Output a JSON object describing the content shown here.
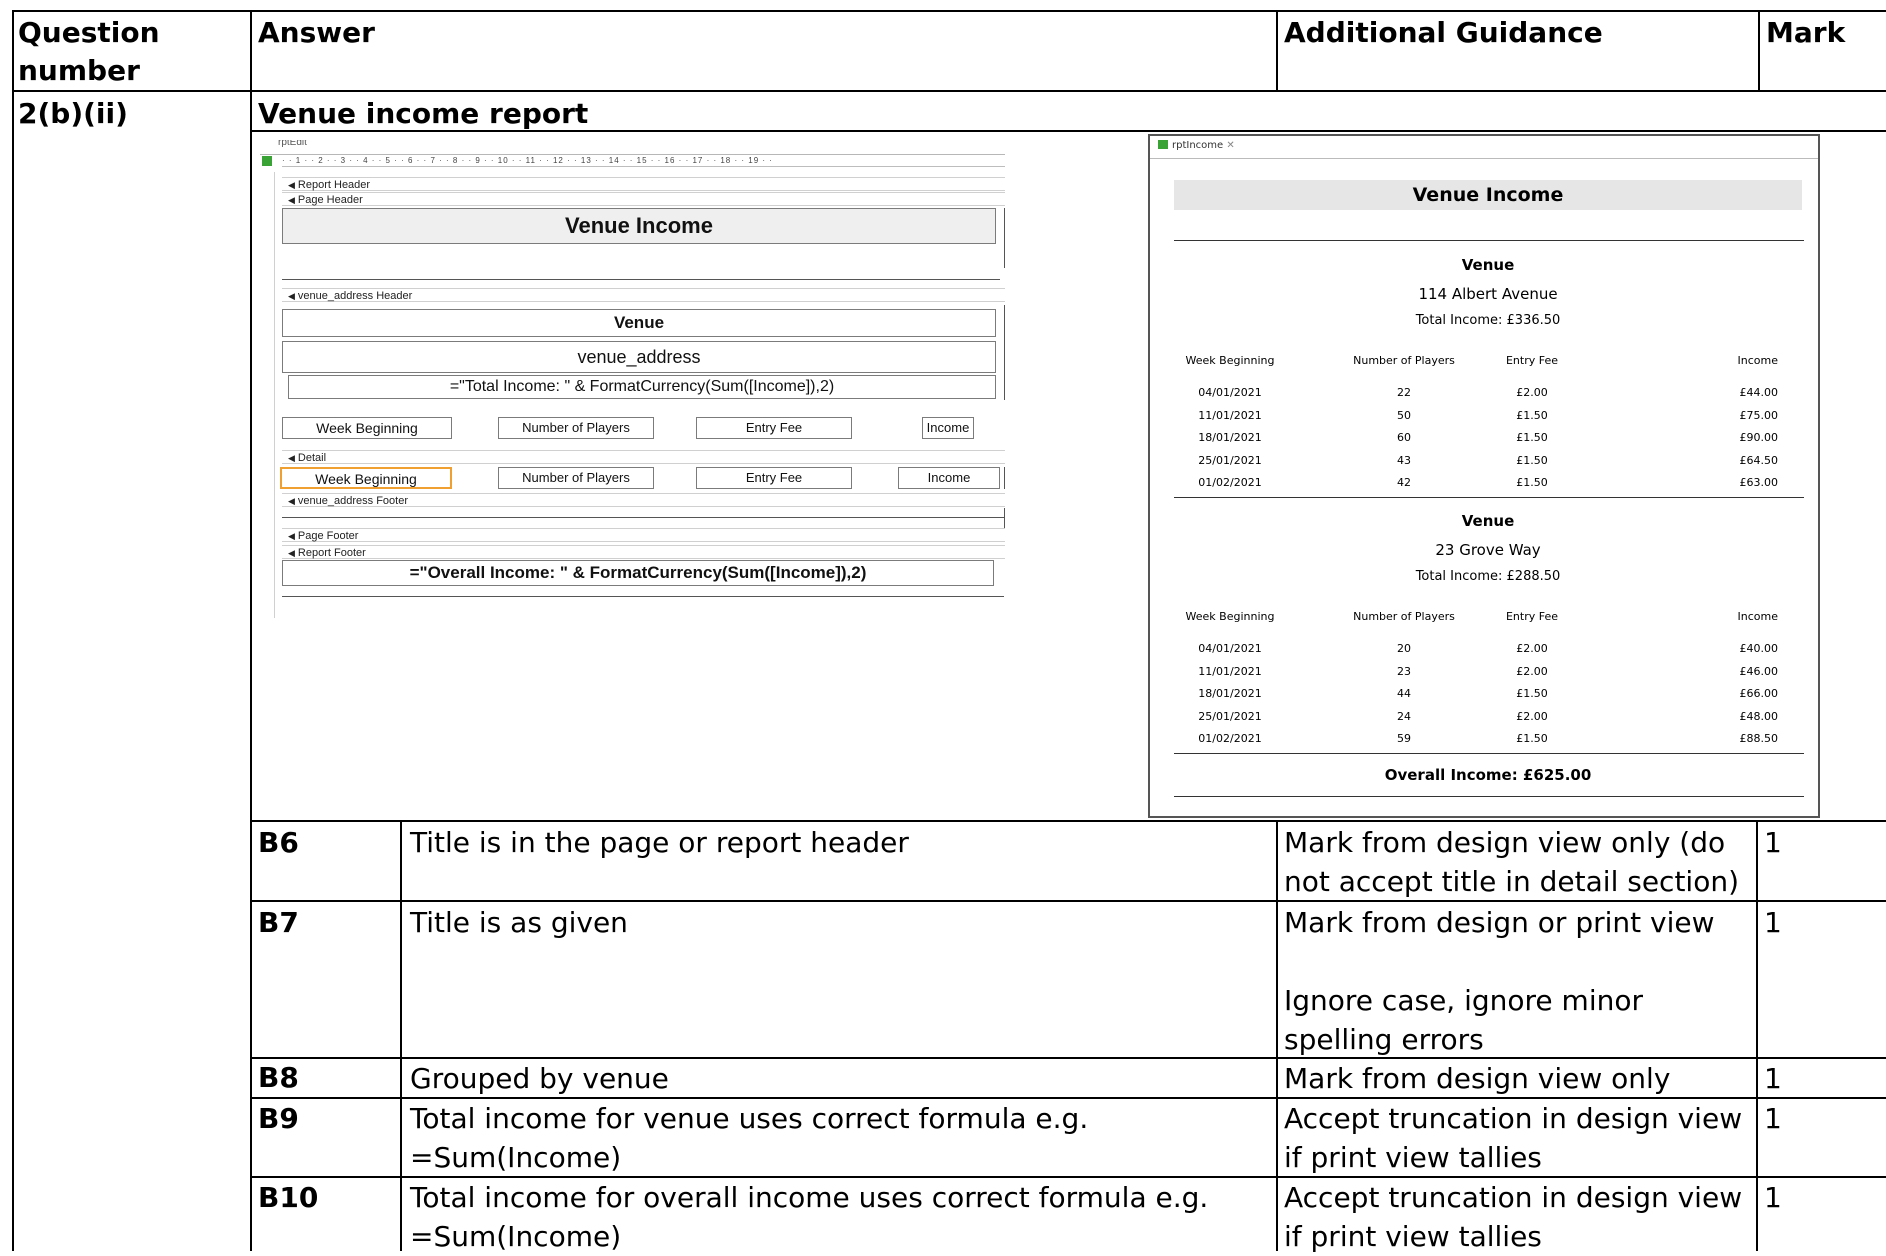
{
  "table": {
    "headers": {
      "question_number": "Question number",
      "answer": "Answer",
      "guidance": "Additional Guidance",
      "mark": "Mark"
    },
    "question": "2(b)(ii)",
    "section_title": "Venue income report",
    "rows": [
      {
        "code": "B6",
        "answer": "Title is in the page or report header",
        "guidance": "Mark from design view only (do not accept title in detail section)",
        "mark": "1"
      },
      {
        "code": "B7",
        "answer": "Title is as given",
        "guidance": "Mark from design or print view",
        "guidance2": "Ignore case, ignore minor spelling errors",
        "mark": "1"
      },
      {
        "code": "B8",
        "answer": "Grouped by venue",
        "guidance": "Mark from design view only",
        "mark": "1"
      },
      {
        "code": "B9",
        "answer": "Total income for venue uses correct formula e.g. =Sum(Income)",
        "guidance": "Accept truncation in design view if print view tallies",
        "mark": "1"
      },
      {
        "code": "B10",
        "answer": "Total income for overall income uses correct formula e.g. =Sum(Income)",
        "guidance": "Accept truncation in design view if print view tallies",
        "mark": "1"
      }
    ]
  },
  "design_view": {
    "tab_title": "rptEdit",
    "ruler": "· · 1 · · 2 · · 3 · · 4 · · 5 · · 6 · · 7 · · 8 · · 9 · · 10 · · 11 · · 12 · · 13 · · 14 · · 15 · · 16 · · 17 · · 18 · · 19 · ·",
    "sections": {
      "report_header": "Report Header",
      "page_header": "Page Header",
      "group_header": "venue_address Header",
      "detail": "Detail",
      "group_footer": "venue_address Footer",
      "page_footer": "Page Footer",
      "report_footer": "Report Footer"
    },
    "title": "Venue Income",
    "venue_label": "Venue",
    "venue_field": "venue_address",
    "total_formula": "=\"Total Income: \" & FormatCurrency(Sum([Income]),2)",
    "column_labels": [
      "Week Beginning",
      "Number of Players",
      "Entry Fee",
      "Income"
    ],
    "detail_fields": [
      "Week Beginning",
      "Number of Players",
      "Entry Fee",
      "Income"
    ],
    "overall_formula": "=\"Overall Income: \" & FormatCurrency(Sum([Income]),2)"
  },
  "print_view": {
    "tab_title": "rptIncome",
    "title": "Venue Income",
    "columns": [
      "Week Beginning",
      "Number of Players",
      "Entry Fee",
      "Income"
    ],
    "groups": [
      {
        "label": "Venue",
        "address": "114 Albert Avenue",
        "total": "Total Income: £336.50",
        "rows": [
          [
            "04/01/2021",
            "22",
            "£2.00",
            "£44.00"
          ],
          [
            "11/01/2021",
            "50",
            "£1.50",
            "£75.00"
          ],
          [
            "18/01/2021",
            "60",
            "£1.50",
            "£90.00"
          ],
          [
            "25/01/2021",
            "43",
            "£1.50",
            "£64.50"
          ],
          [
            "01/02/2021",
            "42",
            "£1.50",
            "£63.00"
          ]
        ]
      },
      {
        "label": "Venue",
        "address": "23 Grove Way",
        "total": "Total Income: £288.50",
        "rows": [
          [
            "04/01/2021",
            "20",
            "£2.00",
            "£40.00"
          ],
          [
            "11/01/2021",
            "23",
            "£2.00",
            "£46.00"
          ],
          [
            "18/01/2021",
            "44",
            "£1.50",
            "£66.00"
          ],
          [
            "25/01/2021",
            "24",
            "£2.00",
            "£48.00"
          ],
          [
            "01/02/2021",
            "59",
            "£1.50",
            "£88.50"
          ]
        ]
      }
    ],
    "overall": "Overall Income: £625.00"
  }
}
